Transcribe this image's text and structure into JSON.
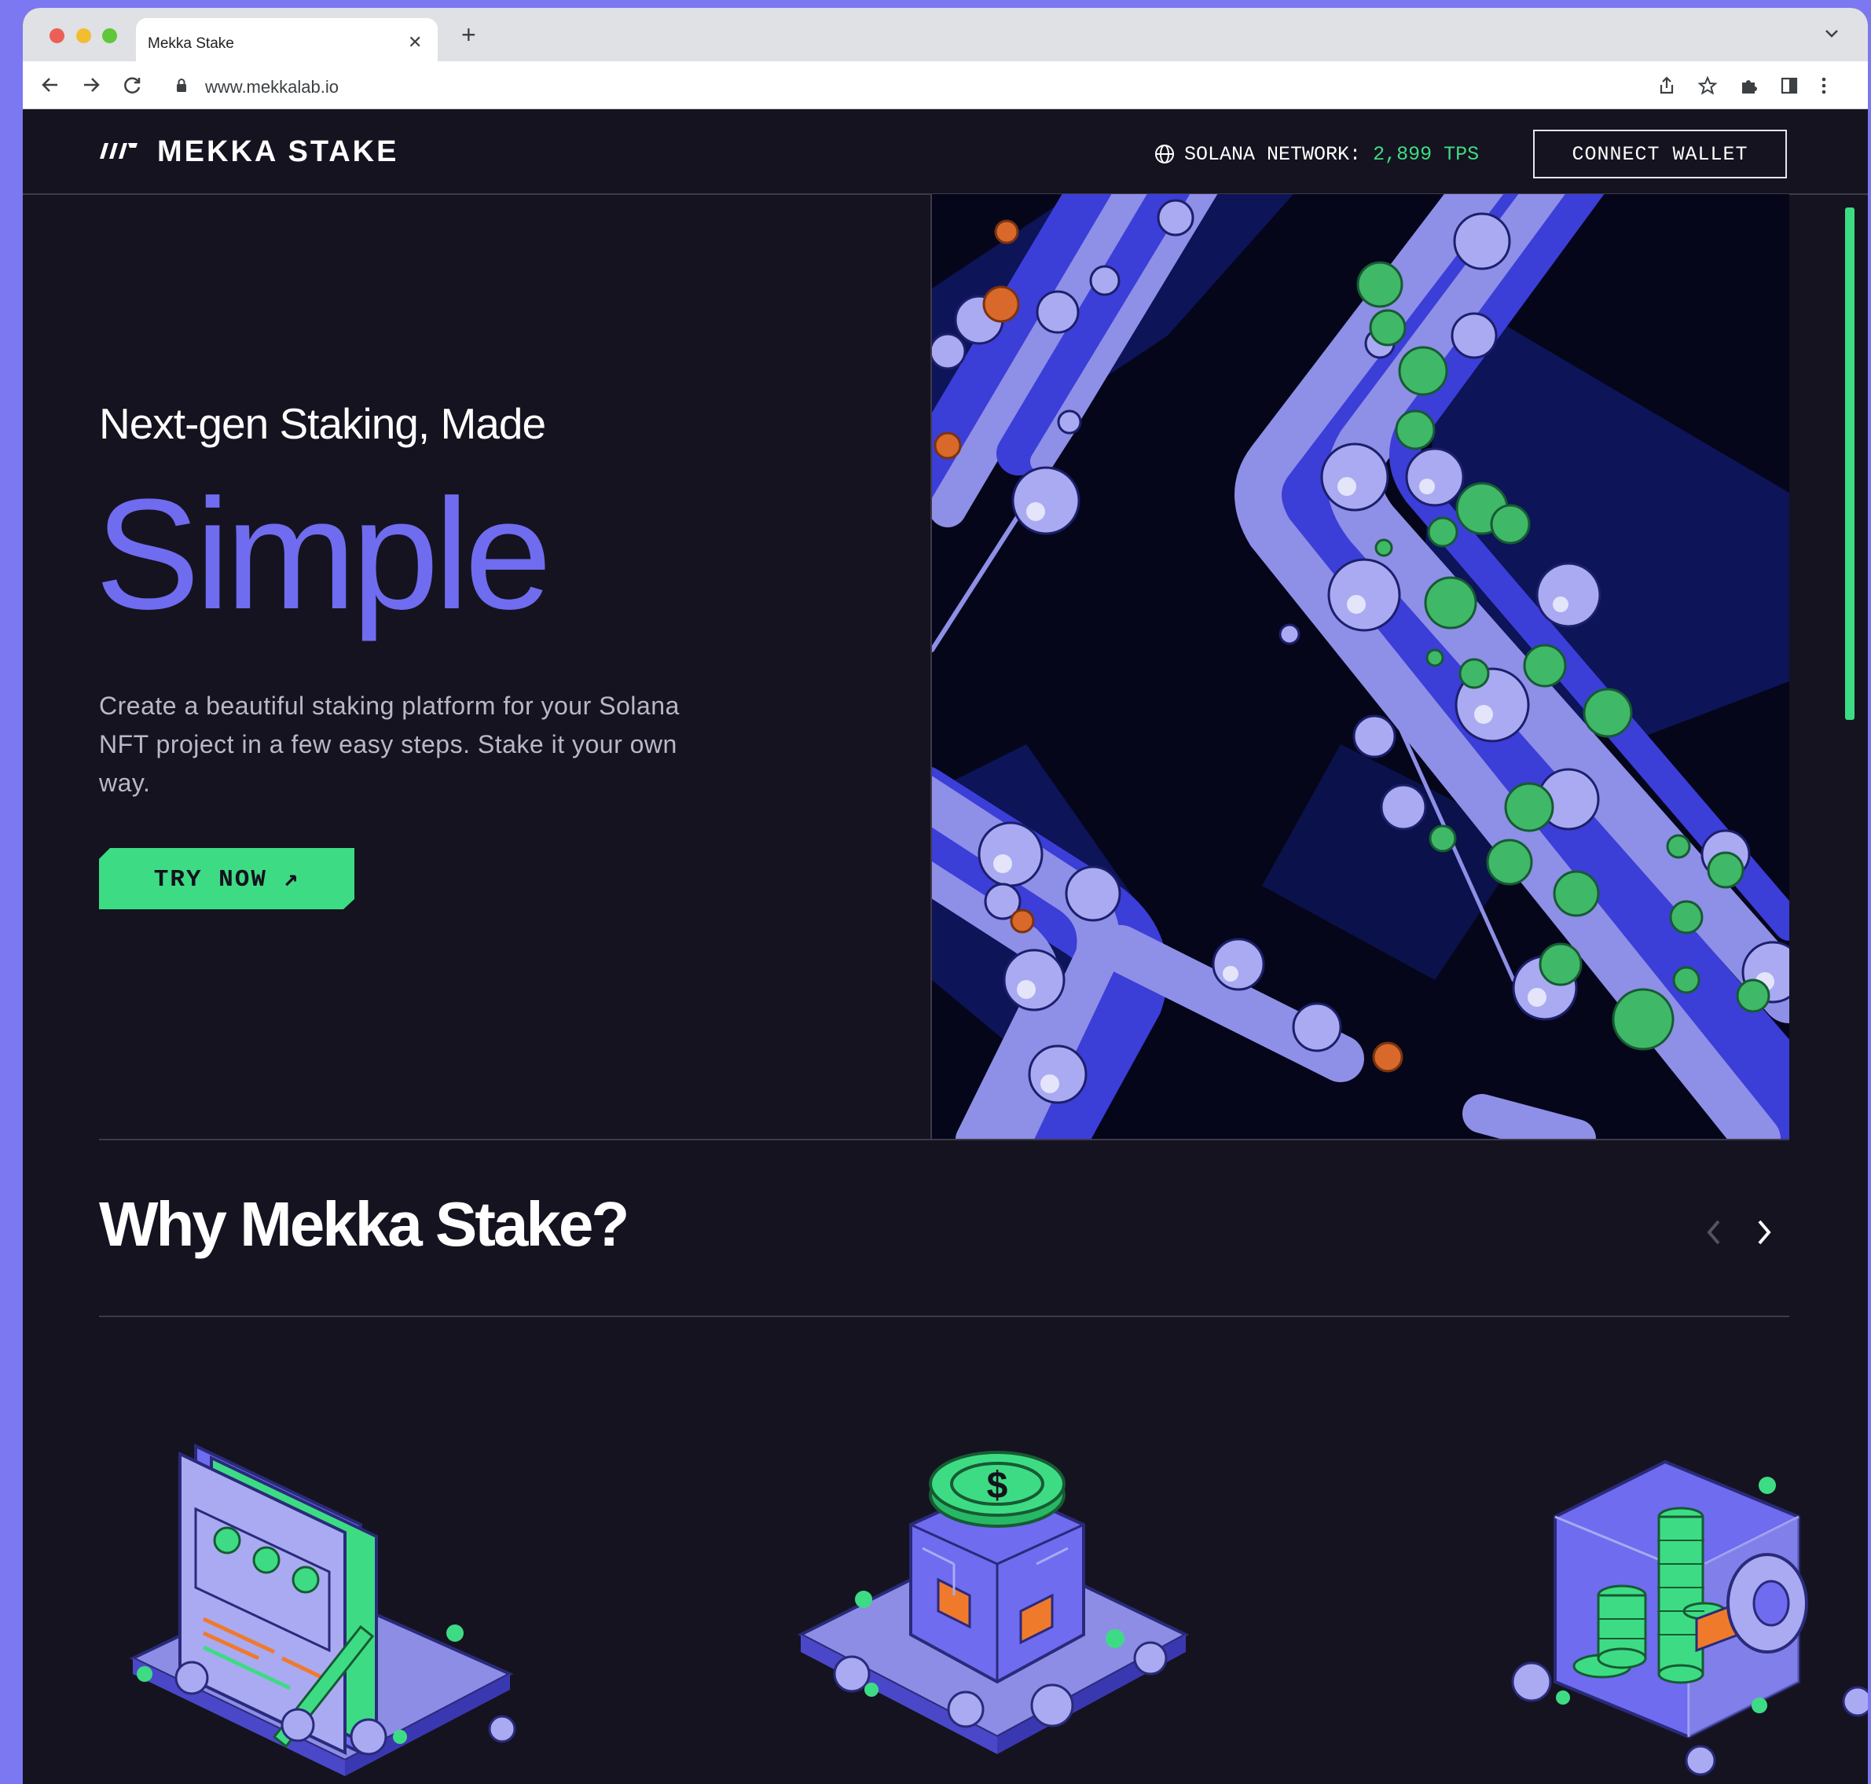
{
  "browser": {
    "tab_title": "Mekka Stake",
    "url": "www.mekkalab.io"
  },
  "header": {
    "logo_text": "MEKKA STAKE",
    "network_label": "SOLANA NETWORK:",
    "network_value": "2,899 TPS",
    "connect_label": "CONNECT WALLET"
  },
  "hero": {
    "kicker": "Next-gen Staking, Made",
    "headline": "Simple",
    "description": "Create a beautiful staking platform for your Solana NFT project in a few easy steps. Stake it your own way.",
    "cta_label": "TRY NOW ↗"
  },
  "why": {
    "title": "Why Mekka Stake?"
  },
  "colors": {
    "accent_purple": "#6f6cf0",
    "accent_green": "#3ddc84",
    "background": "#15131f",
    "orange": "#f07a2c"
  }
}
